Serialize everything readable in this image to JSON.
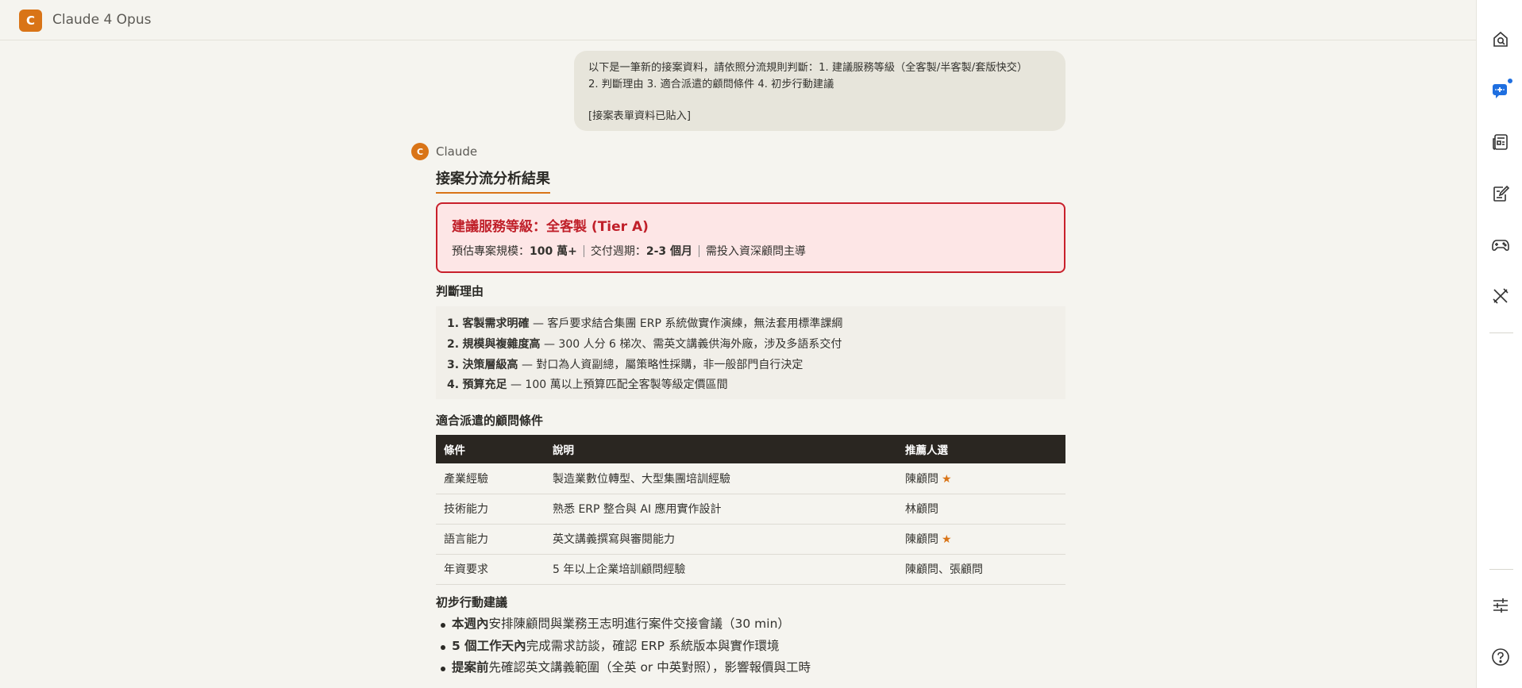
{
  "app": {
    "logo_letter": "C",
    "title": "Claude 4 Opus"
  },
  "user_message": {
    "line1": "以下是一筆新的接案資料，請依照分流規則判斷：1. 建議服務等級（全客製/半客製/套版快交）",
    "line2": "2. 判斷理由 3. 適合派遣的顧問條件 4. 初步行動建議",
    "line3": "[接案表單資料已貼入]"
  },
  "assistant": {
    "avatar_letter": "C",
    "name": "Claude",
    "title": "接案分流分析結果",
    "tier": {
      "title": "建議服務等級：全客製 (Tier A)",
      "scale_label": "預估專案規模：",
      "scale_value": "100 萬+",
      "cycle_label": "交付週期：",
      "cycle_value": "2-3 個月",
      "note": "需投入資深顧問主導"
    },
    "reasons_heading": "判斷理由",
    "reasons": [
      {
        "num": "1.",
        "title": "客製需求明確",
        "text": " — 客戶要求結合集團 ERP 系統做實作演練，無法套用標準課綱"
      },
      {
        "num": "2.",
        "title": "規模與複雜度高",
        "text": " — 300 人分 6 梯次、需英文講義供海外廠，涉及多語系交付"
      },
      {
        "num": "3.",
        "title": "決策層級高",
        "text": " — 對口為人資副總，屬策略性採購，非一般部門自行決定"
      },
      {
        "num": "4.",
        "title": "預算充足",
        "text": " — 100 萬以上預算匹配全客製等級定價區間"
      }
    ],
    "consultant_heading": "適合派遣的顧問條件",
    "table": {
      "headers": [
        "條件",
        "說明",
        "推薦人選"
      ],
      "rows": [
        {
          "condition": "產業經驗",
          "desc": "製造業數位轉型、大型集團培訓經驗",
          "pick": "陳顧問",
          "star": "★"
        },
        {
          "condition": "技術能力",
          "desc": "熟悉 ERP 整合與 AI 應用實作設計",
          "pick": "林顧問",
          "star": ""
        },
        {
          "condition": "語言能力",
          "desc": "英文講義撰寫與審閱能力",
          "pick": "陳顧問",
          "star": "★"
        },
        {
          "condition": "年資要求",
          "desc": "5 年以上企業培訓顧問經驗",
          "pick": "陳顧問、張顧問",
          "star": ""
        }
      ]
    },
    "actions_heading": "初步行動建議",
    "actions": [
      {
        "bold": "本週內",
        "text": "安排陳顧問與業務王志明進行案件交接會議（30 min）"
      },
      {
        "bold": "5 個工作天內",
        "text": "完成需求訪談，確認 ERP 系統版本與實作環境"
      },
      {
        "bold": "提案前",
        "text": "先確認英文講義範圍（全英 or 中英對照），影響報價與工時"
      }
    ]
  },
  "rail_icons": [
    "search-history-icon",
    "new-chat-icon",
    "news-icon",
    "edit-icon",
    "gamepad-icon",
    "tools-icon",
    "settings-sliders-icon",
    "help-icon"
  ],
  "colors": {
    "accent": "#d97417",
    "tier_red": "#c0202a",
    "tier_bg": "#fde6e6",
    "table_header": "#2a2621",
    "notif_blue": "#1f6fe0"
  }
}
